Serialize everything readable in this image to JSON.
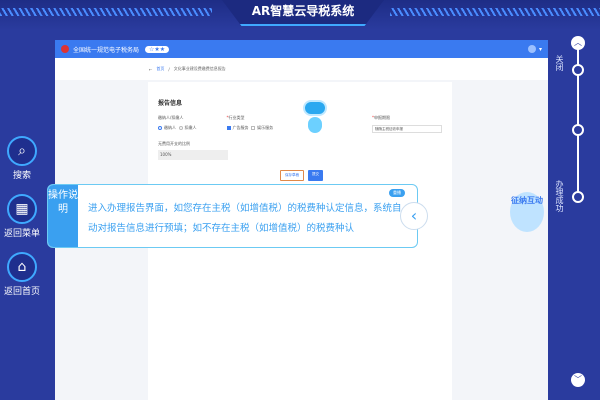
{
  "app": {
    "title": "AR智慧云导税系统"
  },
  "browser": {
    "site_title": "全国统一规范电子税务局",
    "stars": "☆★★",
    "user_menu": "▾"
  },
  "breadcrumb": {
    "back": "←",
    "home": "首页",
    "separator": "/",
    "current": "文化事业建设费缴费信息报告"
  },
  "form": {
    "heading": "报告信息",
    "payer_label": "缴纳人/扣缴人",
    "payer_options": [
      "缴纳人",
      "扣缴人"
    ],
    "industry_label": "行业类型",
    "industry_options": [
      "广告服务",
      "娱乐服务"
    ],
    "period_label": "申报期限",
    "period_value": "随随主税征收申报",
    "ratio_label": "无费用开支的比例",
    "ratio_value": "100%",
    "buttons": {
      "save": "保存草稿",
      "submit": "提交"
    }
  },
  "left_nav": [
    {
      "label": "搜索",
      "icon": "search-icon"
    },
    {
      "label": "返回菜单",
      "icon": "menu-grid-icon"
    },
    {
      "label": "返回首页",
      "icon": "home-icon"
    }
  ],
  "instruction": {
    "tab": "操作说明",
    "replay": "重播",
    "text": "进入办理报告界面，如您存在主税（如增值税）的税费种认定信息，系统自动对报告信息进行预填；如不存在主税（如增值税）的税费种认"
  },
  "avatar": {
    "label": "征纳互动"
  },
  "right_rail": {
    "close": "关闭",
    "success": "办理成功"
  },
  "colors": {
    "background": "#2a3b9e",
    "accent": "#3aa0f0",
    "header": "#3a7af0"
  }
}
